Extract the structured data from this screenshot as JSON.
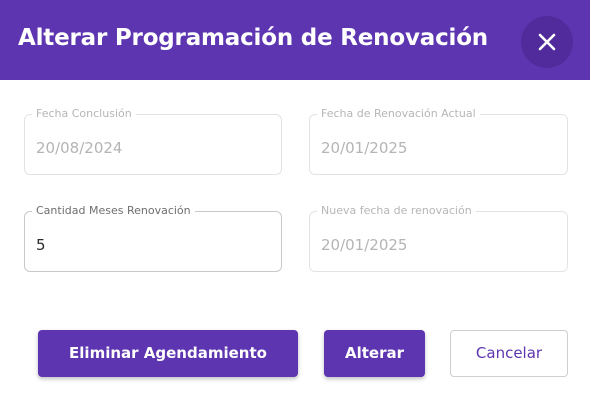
{
  "dialog": {
    "title": "Alterar Programación de Renovación",
    "close_icon": "close-icon",
    "accent_color": "#5e35b1"
  },
  "fields": {
    "fecha_conclusion": {
      "label": "Fecha Conclusión",
      "value": "20/08/2024"
    },
    "fecha_renovacion_actual": {
      "label": "Fecha de Renovación Actual",
      "value": "20/01/2025"
    },
    "cantidad_meses": {
      "label": "Cantidad Meses Renovación",
      "value": "5"
    },
    "nueva_fecha": {
      "label": "Nueva fecha de renovación",
      "value": "20/01/2025"
    }
  },
  "actions": {
    "eliminar_label": "Eliminar Agendamiento",
    "alterar_label": "Alterar",
    "cancelar_label": "Cancelar"
  }
}
